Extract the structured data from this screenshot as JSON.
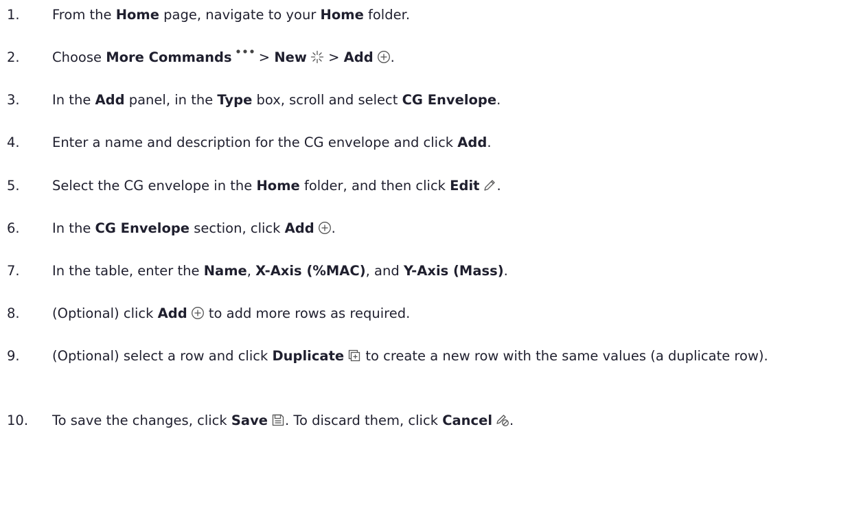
{
  "steps": [
    {
      "num": "1.",
      "parts": [
        {
          "t": "From the "
        },
        {
          "t": "Home",
          "b": true
        },
        {
          "t": " page, navigate to your "
        },
        {
          "t": "Home",
          "b": true
        },
        {
          "t": " folder."
        }
      ]
    },
    {
      "num": "2.",
      "parts": [
        {
          "t": "Choose "
        },
        {
          "t": "More Commands",
          "b": true
        },
        {
          "icon": "more-commands-icon"
        },
        {
          "t": " > "
        },
        {
          "t": "New",
          "b": true
        },
        {
          "icon": "new-sparkle-icon"
        },
        {
          "t": " > "
        },
        {
          "t": "Add",
          "b": true
        },
        {
          "icon": "add-circle-icon"
        },
        {
          "t": "."
        }
      ]
    },
    {
      "num": "3.",
      "parts": [
        {
          "t": "In the "
        },
        {
          "t": "Add",
          "b": true
        },
        {
          "t": " panel, in the "
        },
        {
          "t": "Type",
          "b": true
        },
        {
          "t": " box, scroll and select "
        },
        {
          "t": "CG Envelope",
          "b": true
        },
        {
          "t": "."
        }
      ]
    },
    {
      "num": "4.",
      "parts": [
        {
          "t": "Enter a name and description for the CG envelope and click "
        },
        {
          "t": "Add",
          "b": true
        },
        {
          "t": "."
        }
      ]
    },
    {
      "num": "5.",
      "parts": [
        {
          "t": "Select the CG envelope in the "
        },
        {
          "t": "Home",
          "b": true
        },
        {
          "t": " folder, and then click "
        },
        {
          "t": "Edit",
          "b": true
        },
        {
          "icon": "edit-pencil-icon"
        },
        {
          "t": "."
        }
      ]
    },
    {
      "num": "6.",
      "parts": [
        {
          "t": "In the "
        },
        {
          "t": "CG Envelope",
          "b": true
        },
        {
          "t": " section, click "
        },
        {
          "t": "Add",
          "b": true
        },
        {
          "icon": "add-circle-icon"
        },
        {
          "t": "."
        }
      ]
    },
    {
      "num": "7.",
      "parts": [
        {
          "t": "In the table, enter the "
        },
        {
          "t": "Name",
          "b": true
        },
        {
          "t": ", "
        },
        {
          "t": "X-Axis (%MAC)",
          "b": true
        },
        {
          "t": ", and "
        },
        {
          "t": "Y-Axis (Mass)",
          "b": true
        },
        {
          "t": "."
        }
      ]
    },
    {
      "num": "8.",
      "parts": [
        {
          "t": "(Optional) click "
        },
        {
          "t": "Add",
          "b": true
        },
        {
          "icon": "add-circle-icon"
        },
        {
          "t": " to add more rows as required."
        }
      ]
    },
    {
      "num": "9.",
      "wrap": true,
      "parts": [
        {
          "t": "(Optional) select a row and click "
        },
        {
          "t": "Duplicate",
          "b": true
        },
        {
          "icon": "duplicate-icon"
        },
        {
          "t": " to create a new row with the same values (a duplicate row)."
        }
      ]
    },
    {
      "num": "10.",
      "parts": [
        {
          "t": "To save the changes, click "
        },
        {
          "t": "Save",
          "b": true
        },
        {
          "icon": "save-icon"
        },
        {
          "t": ". To discard them, click "
        },
        {
          "t": "Cancel",
          "b": true
        },
        {
          "icon": "cancel-edit-icon"
        },
        {
          "t": "."
        }
      ]
    }
  ]
}
